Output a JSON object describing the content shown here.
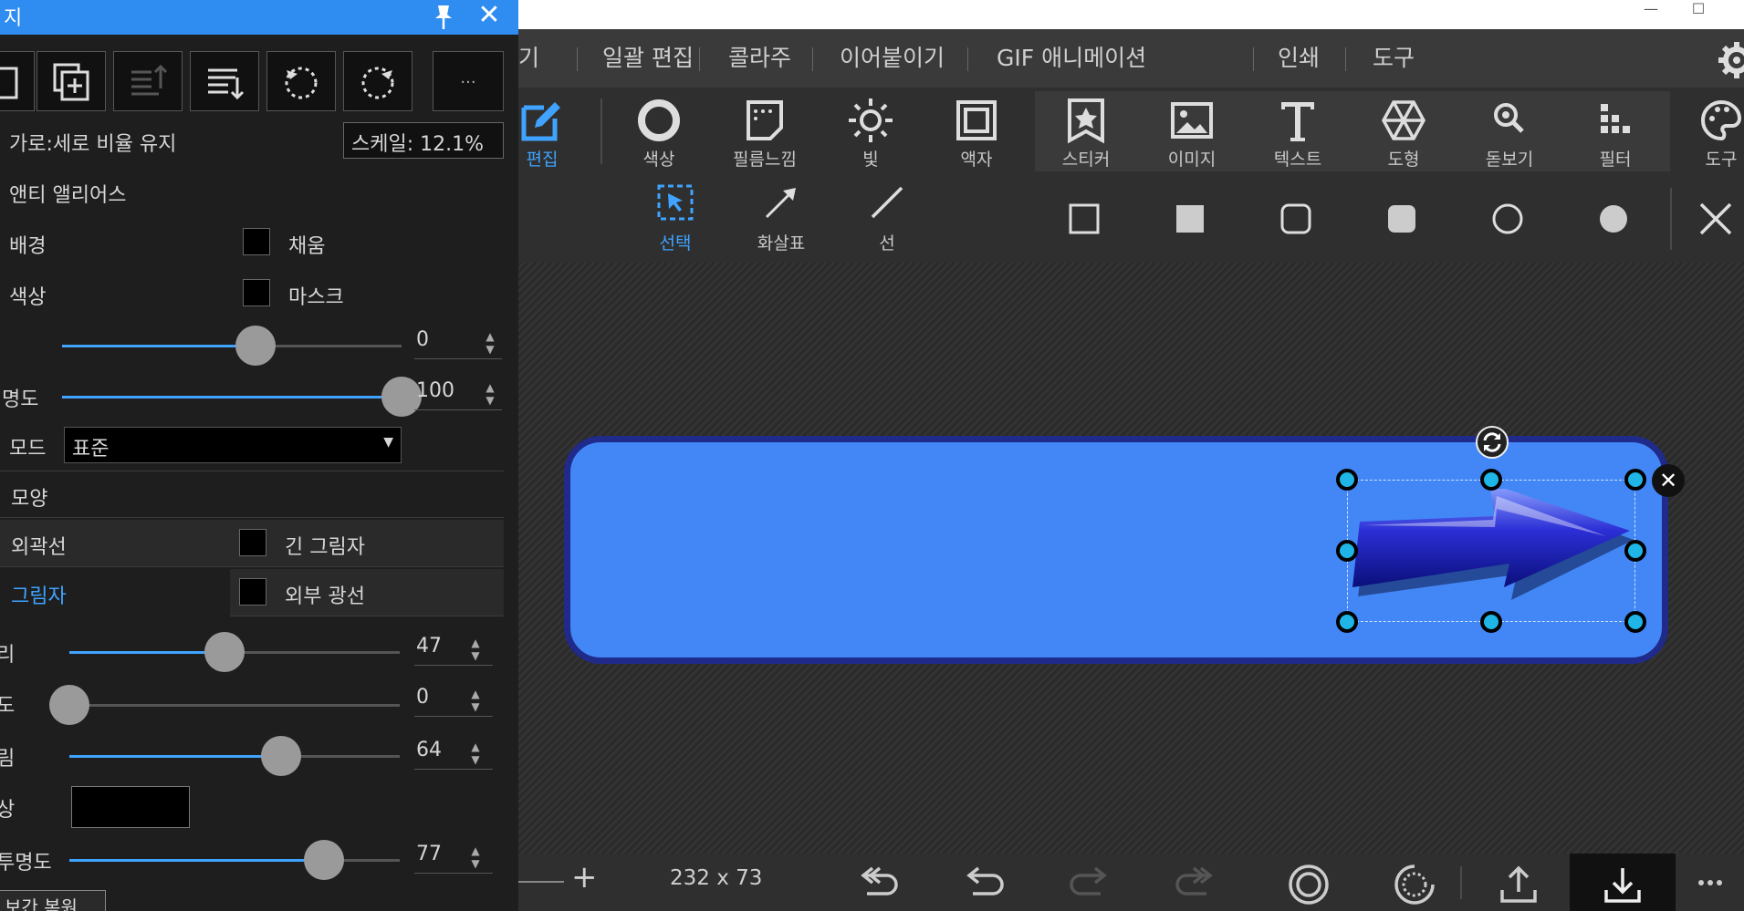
{
  "panel": {
    "title": "지",
    "aspect_label": "가로:세로 비율 유지",
    "scale_label": "스케일: 12.1%",
    "antialias_label": "앤티 앨리어스",
    "background_label": "배경",
    "fill_label": "채움",
    "color_label": "색상",
    "mask_label": "마스크",
    "slider1_value": "0",
    "slider1_level": 0.57,
    "opacity_label": "명도",
    "opacity_value": "100",
    "opacity_level": 1.0,
    "mode_label": "모드",
    "mode_value": "표준",
    "shape_section": "모양",
    "outline_label": "외곽선",
    "long_shadow_label": "긴 그림자",
    "shadow_label": "그림자",
    "outer_glow_label": "외부 광선",
    "shadow_dist_label": "리",
    "shadow_dist_value": "47",
    "shadow_dist_level": 0.47,
    "shadow_angle_label": "도",
    "shadow_angle_value": "0",
    "shadow_angle_level": 0.0,
    "shadow_blur_label": "림",
    "shadow_blur_value": "64",
    "shadow_blur_level": 0.64,
    "shadow_color_label": "상",
    "shadow_color": "#000000",
    "shadow_opacity_label": "투명도",
    "shadow_opacity_value": "77",
    "shadow_opacity_level": 0.77,
    "reset_label": "보간 복원",
    "more_button": "..."
  },
  "menu": {
    "items": [
      "기",
      "일괄 편집",
      "콜라주",
      "이어붙이기",
      "GIF 애니메이션",
      "인쇄",
      "도구"
    ]
  },
  "toolbar1": {
    "edit": "편집",
    "color": "색상",
    "film": "필름느낌",
    "light": "빛",
    "frame": "액자",
    "sticker": "스티커",
    "image": "이미지",
    "text": "텍스트",
    "shape": "도형",
    "magnifier": "돋보기",
    "filter": "필터",
    "tools": "도구"
  },
  "toolbar2": {
    "select": "선택",
    "arrow": "화살표",
    "line": "선"
  },
  "status": {
    "size_readout": "232 x 73"
  },
  "colors": {
    "accent": "#3fa3ff",
    "panel_title": "#2f8cf0",
    "banner_fill": "#4287f5",
    "banner_border": "#1f2a8a",
    "handle": "#1fb5e6"
  }
}
